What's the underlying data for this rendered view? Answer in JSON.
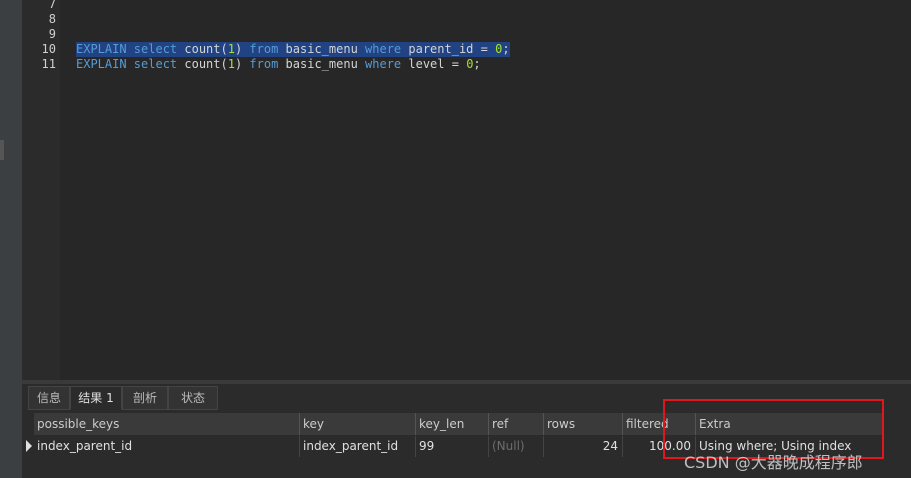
{
  "editor": {
    "line_numbers": [
      "7",
      "8",
      "9",
      "10",
      "11"
    ],
    "lines": [
      {
        "t1": "EXPLAIN select",
        "t2": " count(",
        "n": "1",
        "t3": ") ",
        "k2": "from",
        "t4": " basic_menu ",
        "k3": "where",
        "t5": " parent_id = ",
        "n2": "0",
        "t6": ";"
      },
      {
        "t1": "EXPLAIN select",
        "t2": " count(",
        "n": "1",
        "t3": ") ",
        "k2": "from",
        "t4": " basic_menu ",
        "k3": "where",
        "t5": " level = ",
        "n2": "0",
        "t6": ";"
      }
    ]
  },
  "tabs": [
    {
      "label": "信息"
    },
    {
      "label": "结果 1"
    },
    {
      "label": "剖析"
    },
    {
      "label": "状态"
    }
  ],
  "table": {
    "columns": [
      "possible_keys",
      "key",
      "key_len",
      "ref",
      "rows",
      "filtered",
      "Extra"
    ],
    "rows": [
      [
        "index_parent_id",
        "index_parent_id",
        "99",
        "(Null)",
        "24",
        "100.00",
        "Using where; Using index"
      ]
    ]
  },
  "watermark": "CSDN @大器晚成程序郎",
  "colors": {
    "highlight": "#214283",
    "keyword": "#569cd6",
    "number": "#a6e22e",
    "annotation_box": "#e0181e"
  }
}
